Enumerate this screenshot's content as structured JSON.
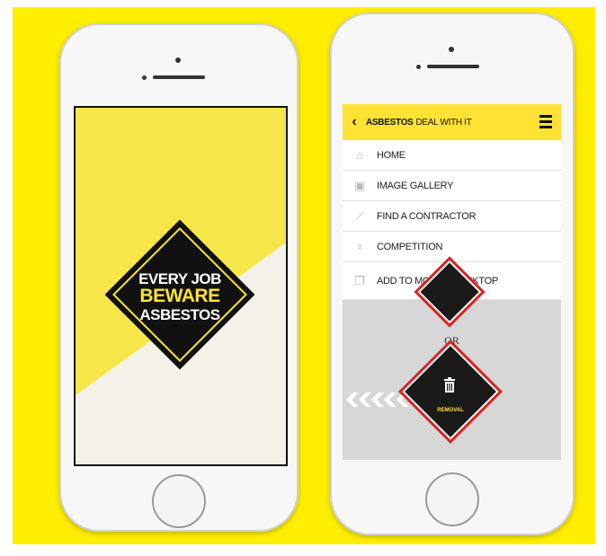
{
  "splash": {
    "line1": "EVERY JOB",
    "line2": "BEWARE",
    "line3": "ASBESTOS"
  },
  "app": {
    "back_icon": "chevron-left-icon",
    "title_main": "ASBESTOS",
    "title_sub": "DEAL WITH IT",
    "menu_icon": "hamburger-icon"
  },
  "menu": {
    "items": [
      {
        "label": "HOME",
        "icon": "home-icon"
      },
      {
        "label": "IMAGE GALLERY",
        "icon": "image-icon"
      },
      {
        "label": "FIND A CONTRACTOR",
        "icon": "wrench-icon"
      },
      {
        "label": "COMPETITION",
        "icon": "trophy-icon"
      },
      {
        "label": "ADD TO MOBILE DESKTOP",
        "icon": "bookmark-icon"
      }
    ]
  },
  "content": {
    "or_text": "OR",
    "removal_label": "REMOVAL"
  },
  "colors": {
    "background": "#ffee00",
    "accent_yellow": "#ffe234",
    "sign_red": "#d82424",
    "dark": "#111111"
  }
}
